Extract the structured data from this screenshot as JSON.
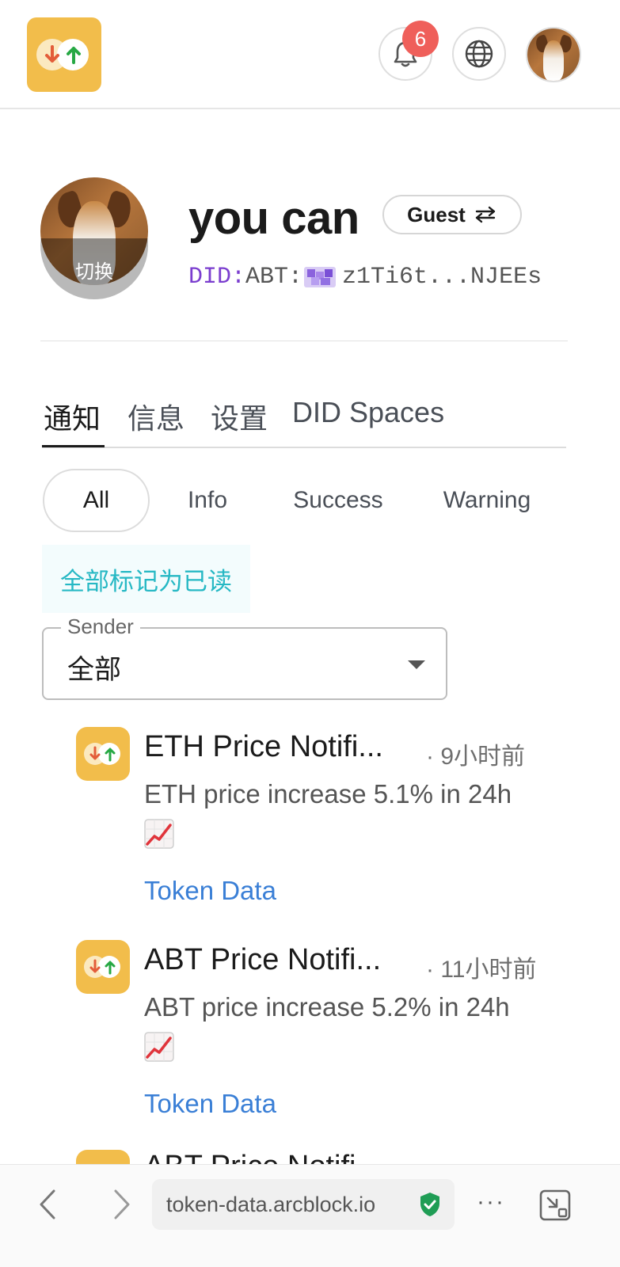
{
  "header": {
    "app_logo": "token-data-logo",
    "notification_count": "6",
    "bell_icon": "bell-icon",
    "globe_icon": "globe-icon",
    "avatar": "user-avatar"
  },
  "profile": {
    "name": "you can",
    "switch_label": "切换",
    "role": "Guest",
    "role_icon": "swap-arrows-icon",
    "did_prefix": "DID:",
    "did_method": "ABT:",
    "did_value": "z1Ti6t...NJEEs"
  },
  "tabs": [
    {
      "label": "通知",
      "active": true
    },
    {
      "label": "信息",
      "active": false
    },
    {
      "label": "设置",
      "active": false
    },
    {
      "label": "DID Spaces",
      "active": false
    }
  ],
  "filters": [
    {
      "label": "All",
      "selected": true
    },
    {
      "label": "Info",
      "selected": false
    },
    {
      "label": "Success",
      "selected": false
    },
    {
      "label": "Warning",
      "selected": false
    }
  ],
  "mark_all_read": "全部标记为已读",
  "sender": {
    "legend": "Sender",
    "value": "全部"
  },
  "notifications": [
    {
      "title": "ETH Price Notifi...",
      "time": "· 9小时前",
      "body": "ETH price increase 5.1% in 24h",
      "emoji": "chart-increasing-emoji",
      "link": "Token Data"
    },
    {
      "title": "ABT Price Notifi...",
      "time": "· 11小时前",
      "body": "ABT price increase 5.2% in 24h",
      "emoji": "chart-increasing-emoji",
      "link": "Token Data"
    }
  ],
  "partial_notification_title": "ABT Price Notifi...",
  "browser": {
    "url": "token-data.arcblock.io",
    "more": "···"
  },
  "colors": {
    "brand_yellow": "#f2bd4b",
    "badge_red": "#ef5f5a",
    "mark_read_text": "#26b8c4",
    "link_blue": "#3a7fd6",
    "did_purple": "#7b3ecf",
    "secure_green": "#1f9d55"
  }
}
